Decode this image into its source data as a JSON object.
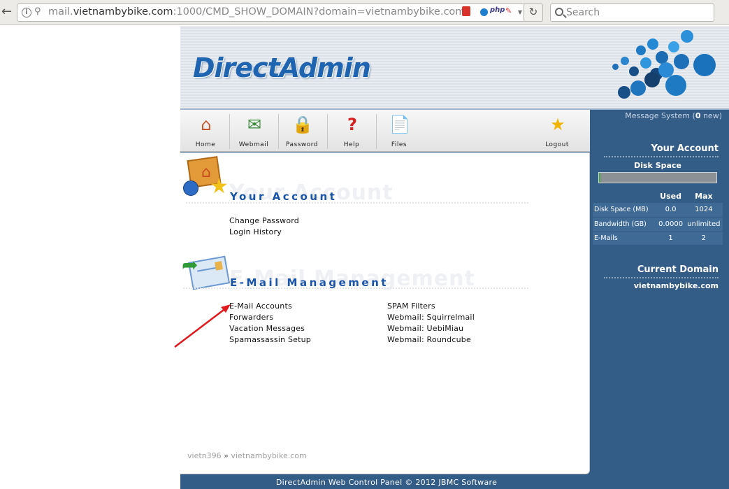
{
  "browser": {
    "url_prefix": "mail.",
    "url_domain": "vietnambybike.com",
    "url_rest": ":1000/CMD_SHOW_DOMAIN?domain=vietnambybike.com",
    "addon_php": "php",
    "search_placeholder": "Search"
  },
  "header": {
    "logo": "DirectAdmin"
  },
  "toolbar": [
    {
      "label": "Home",
      "icon": "home-icon"
    },
    {
      "label": "Webmail",
      "icon": "webmail-icon"
    },
    {
      "label": "Password",
      "icon": "lock-icon"
    },
    {
      "label": "Help",
      "icon": "help-icon"
    },
    {
      "label": "Files",
      "icon": "files-icon"
    },
    {
      "label": "Logout",
      "icon": "logout-star-icon"
    }
  ],
  "your_account": {
    "ghost": "Your Account",
    "title": "Your Account",
    "links": [
      "Change Password",
      "Login History"
    ]
  },
  "email_management": {
    "ghost": "E-Mail Management",
    "title": "E-Mail Management",
    "links_left": [
      "E-Mail Accounts",
      "Forwarders",
      "Vacation Messages",
      "Spamassassin Setup"
    ],
    "links_right": [
      "SPAM Filters",
      "Webmail: Squirrelmail",
      "Webmail: UebiMiau",
      "Webmail: Roundcube"
    ]
  },
  "breadcrumb": {
    "user": "vietn396",
    "separator": "»",
    "domain": "vietnambybike.com"
  },
  "footer": "DirectAdmin Web Control Panel © 2012 JBMC Software",
  "sidebar": {
    "message_prefix": "Message System (",
    "message_count": "0",
    "message_suffix": " new)",
    "your_account": "Your Account",
    "disk_space": "Disk Space",
    "disk_usage_fraction": 0.0,
    "col_used": "Used",
    "col_max": "Max",
    "rows": [
      {
        "label": "Disk Space (MB)",
        "used": "0.0",
        "max": "1024"
      },
      {
        "label": "Bandwidth (GB)",
        "used": "0.0000",
        "max": "unlimited"
      },
      {
        "label": "E-Mails",
        "used": "1",
        "max": "2"
      }
    ],
    "current_domain_title": "Current Domain",
    "current_domain": "vietnambybike.com"
  },
  "colors": {
    "panel_blue": "#335c87",
    "title_blue": "#1a54a6",
    "annotation_red": "#e0191c"
  }
}
